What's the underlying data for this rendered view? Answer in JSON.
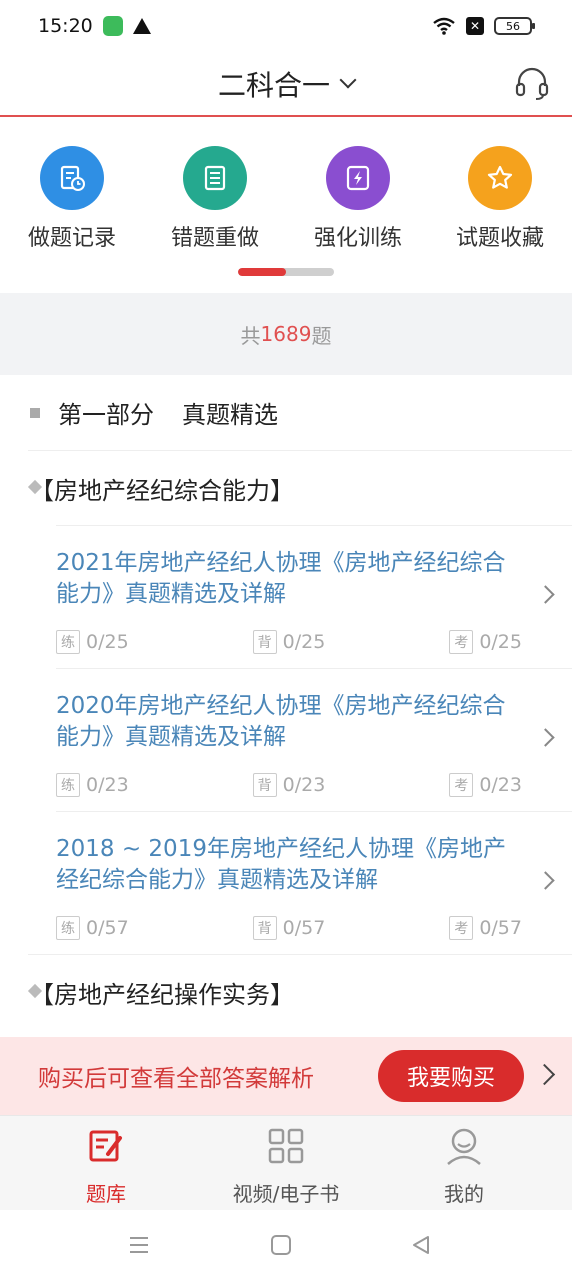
{
  "status": {
    "time": "15:20",
    "battery": "56"
  },
  "header": {
    "title": "二科合一"
  },
  "quick_actions": [
    {
      "label": "做题记录",
      "color": "#2f8fe4",
      "icon": "record-clock-icon"
    },
    {
      "label": "错题重做",
      "color": "#25a98f",
      "icon": "notebook-icon"
    },
    {
      "label": "强化训练",
      "color": "#8a4ed0",
      "icon": "lightning-icon"
    },
    {
      "label": "试题收藏",
      "color": "#f5a21d",
      "icon": "star-icon"
    }
  ],
  "total": {
    "prefix": "共",
    "count": "1689",
    "suffix": "题"
  },
  "section": {
    "part": "第一部分",
    "name": "真题精选"
  },
  "subsections": [
    {
      "label": "【房地产经纪综合能力】"
    },
    {
      "label": "【房地产经纪操作实务】"
    }
  ],
  "items": [
    {
      "title": "2021年房地产经纪人协理《房地产经纪综合能力》真题精选及详解",
      "practice_tag": "练",
      "practice": "0/25",
      "memorize_tag": "背",
      "memorize": "0/25",
      "exam_tag": "考",
      "exam": "0/25"
    },
    {
      "title": "2020年房地产经纪人协理《房地产经纪综合能力》真题精选及详解",
      "practice_tag": "练",
      "practice": "0/23",
      "memorize_tag": "背",
      "memorize": "0/23",
      "exam_tag": "考",
      "exam": "0/23"
    },
    {
      "title": "2018 ~ 2019年房地产经纪人协理《房地产经纪综合能力》真题精选及详解",
      "practice_tag": "练",
      "practice": "0/57",
      "memorize_tag": "背",
      "memorize": "0/57",
      "exam_tag": "考",
      "exam": "0/57"
    }
  ],
  "buy": {
    "text": "购买后可查看全部答案解析",
    "button": "我要购买"
  },
  "tabs": [
    {
      "label": "题库",
      "active": true
    },
    {
      "label": "视频/电子书",
      "active": false
    },
    {
      "label": "我的",
      "active": false
    }
  ]
}
